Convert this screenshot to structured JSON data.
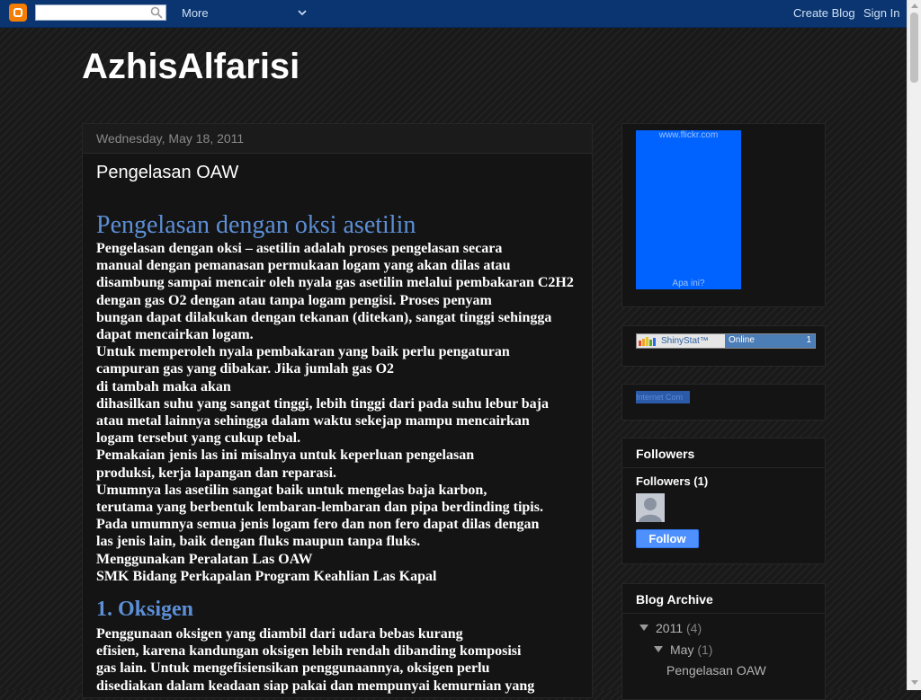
{
  "navbar": {
    "search_placeholder": "",
    "more_label": "More",
    "create_blog_label": "Create Blog",
    "sign_in_label": "Sign In",
    "brand_color": "#f57d00",
    "bar_color": "#0b3570"
  },
  "blog": {
    "title": "AzhisAlfarisi"
  },
  "post": {
    "date": "Wednesday, May 18, 2011",
    "title": "Pengelasan OAW",
    "heading1": "Pengelasan dengan oksi asetilin",
    "lines1": [
      "Pengelasan dengan oksi – asetilin adalah proses pengelasan secara",
      "manual dengan pemanasan permukaan logam yang akan dilas atau",
      "disambung sampai mencair oleh nyala gas asetilin melalui pembakaran C2H2",
      "dengan gas O2 dengan atau tanpa logam pengisi. Proses penyam",
      "bungan dapat dilakukan dengan tekanan (ditekan), sangat tinggi sehingga",
      "dapat mencairkan logam.",
      "Untuk memperoleh nyala pembakaran yang baik perlu pengaturan",
      "campuran gas yang dibakar. Jika jumlah gas O2",
      "di tambah maka akan",
      "dihasilkan suhu yang sangat tinggi, lebih tinggi dari pada suhu lebur baja",
      "atau metal lainnya sehingga dalam waktu sekejap mampu mencairkan",
      "logam tersebut yang cukup tebal.",
      "Pemakaian jenis las ini misalnya untuk keperluan pengelasan",
      "produksi, kerja lapangan dan reparasi.",
      "Umumnya las asetilin sangat baik untuk mengelas baja karbon,",
      "terutama yang berbentuk lembaran-lembaran dan pipa berdinding tipis.",
      "Pada umumnya semua jenis logam fero dan non fero dapat dilas dengan",
      "las jenis lain, baik dengan fluks maupun tanpa fluks.",
      "Menggunakan Peralatan Las OAW",
      "SMK Bidang Perkapalan Program Keahlian Las Kapal"
    ],
    "heading2": "1. Oksigen",
    "lines2": [
      "Penggunaan oksigen yang diambil dari udara bebas kurang",
      "efisien, karena kandungan oksigen lebih rendah dibanding komposisi",
      "gas lain. Untuk mengefisiensikan penggunaannya, oksigen perlu",
      "disediakan dalam keadaan siap pakai dan mempunyai kemurnian yang"
    ],
    "heading_color": "#5c8fd6"
  },
  "sidebar": {
    "flickr": {
      "top_text": "www.flickr.com",
      "bottom_text": "Apa ini?",
      "box_color": "#0063ff"
    },
    "shinystat": {
      "logo_text": "ShinyStat™",
      "online_label": "Online",
      "online_count": "1"
    },
    "small_link": "Internet Com",
    "followers": {
      "title": "Followers",
      "count_label": "Followers (1)",
      "follow_label": "Follow"
    },
    "archive": {
      "title": "Blog Archive",
      "year": "2011",
      "year_count": "(4)",
      "month": "May",
      "month_count": "(1)",
      "post": "Pengelasan OAW"
    }
  }
}
